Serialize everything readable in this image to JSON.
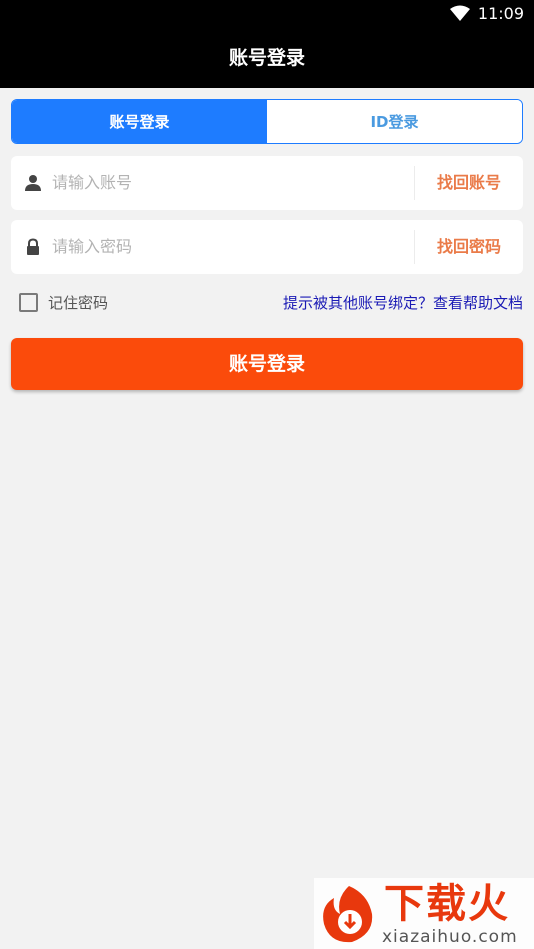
{
  "status_bar": {
    "time": "11:09"
  },
  "app_bar": {
    "title": "账号登录"
  },
  "tabs": [
    {
      "label": "账号登录",
      "active": true
    },
    {
      "label": "ID登录",
      "active": false
    }
  ],
  "account_field": {
    "placeholder": "请输入账号",
    "link": "找回账号"
  },
  "password_field": {
    "placeholder": "请输入密码",
    "link": "找回密码"
  },
  "remember": {
    "label": "记住密码",
    "checked": false
  },
  "help_link": "提示被其他账号绑定？查看帮助文档",
  "login_button": "账号登录",
  "watermark": {
    "brand": "下载火",
    "domain": "xiazaihuo.com"
  },
  "colors": {
    "primary_blue": "#1e7cff",
    "accent_orange": "#fb4b0b",
    "link_orange": "#ea7b49",
    "help_link_blue": "#1a1ab5"
  }
}
